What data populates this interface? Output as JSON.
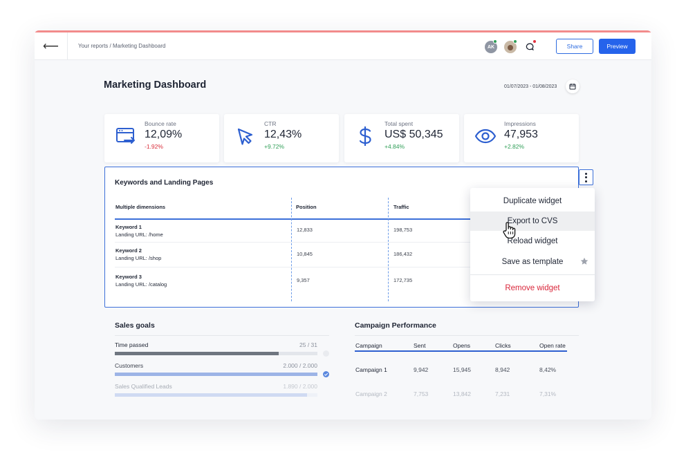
{
  "topbar": {
    "back_glyph": "⟵",
    "breadcrumb": "Your reports / Marketing Dashboard",
    "avatar_initials": "AK",
    "share_label": "Share",
    "preview_label": "Preview"
  },
  "page": {
    "title": "Marketing Dashboard",
    "date_range": "01/07/2023 - 01/08/2023"
  },
  "kpis": [
    {
      "icon": "browser-arrow-icon",
      "label": "Bounce rate",
      "value": "12,09%",
      "change": "-1.92%"
    },
    {
      "icon": "cursor-arrow-icon",
      "label": "CTR",
      "value": "12,43%",
      "change": "+9.72%"
    },
    {
      "icon": "dollar-icon",
      "label": "Total spent",
      "value": "US$ 50,345",
      "change": "+4.84%"
    },
    {
      "icon": "eye-icon",
      "label": "Impressions",
      "value": "47,953",
      "change": "+2.82%"
    }
  ],
  "keywords_widget": {
    "title": "Keywords and Landing Pages",
    "columns": [
      "Multiple dimensions",
      "Position",
      "Traffic"
    ],
    "rows": [
      {
        "keyword": "Keyword 1",
        "url": "Landing URL: /home",
        "position": "12,833",
        "traffic": "198,753"
      },
      {
        "keyword": "Keyword 2",
        "url": "Landing URL: /shop",
        "position": "10,845",
        "traffic": "186,432"
      },
      {
        "keyword": "Keyword 3",
        "url": "Landing URL: /catalog",
        "position": "9,357",
        "traffic": "172,735"
      }
    ]
  },
  "context_menu": {
    "items": [
      "Duplicate widget",
      "Export to CVS",
      "Reload widget",
      "Save as template"
    ],
    "danger_item": "Remove widget",
    "hovered_index": 1
  },
  "sales_goals": {
    "title": "Sales goals",
    "goals": [
      {
        "label": "Time passed",
        "value": "25 / 31",
        "progress": 0.81
      },
      {
        "label": "Customers",
        "value": "2.000 / 2.000",
        "progress": 1.0
      },
      {
        "label": "Sales Qualified Leads",
        "value": "1.890 / 2.000",
        "progress": 0.95
      }
    ]
  },
  "campaign_performance": {
    "title": "Campaign Performance",
    "columns": [
      "Campaign",
      "Sent",
      "Opens",
      "Clicks",
      "Open rate"
    ],
    "rows": [
      [
        "Campaign 1",
        "9,942",
        "15,945",
        "8,942",
        "8,42%"
      ],
      [
        "Campaign 2",
        "7,753",
        "13,842",
        "7,231",
        "7,31%"
      ]
    ]
  },
  "colors": {
    "accent": "#2563eb",
    "negative": "#d92d3a",
    "positive": "#2f9e57",
    "danger": "#d9263a"
  }
}
